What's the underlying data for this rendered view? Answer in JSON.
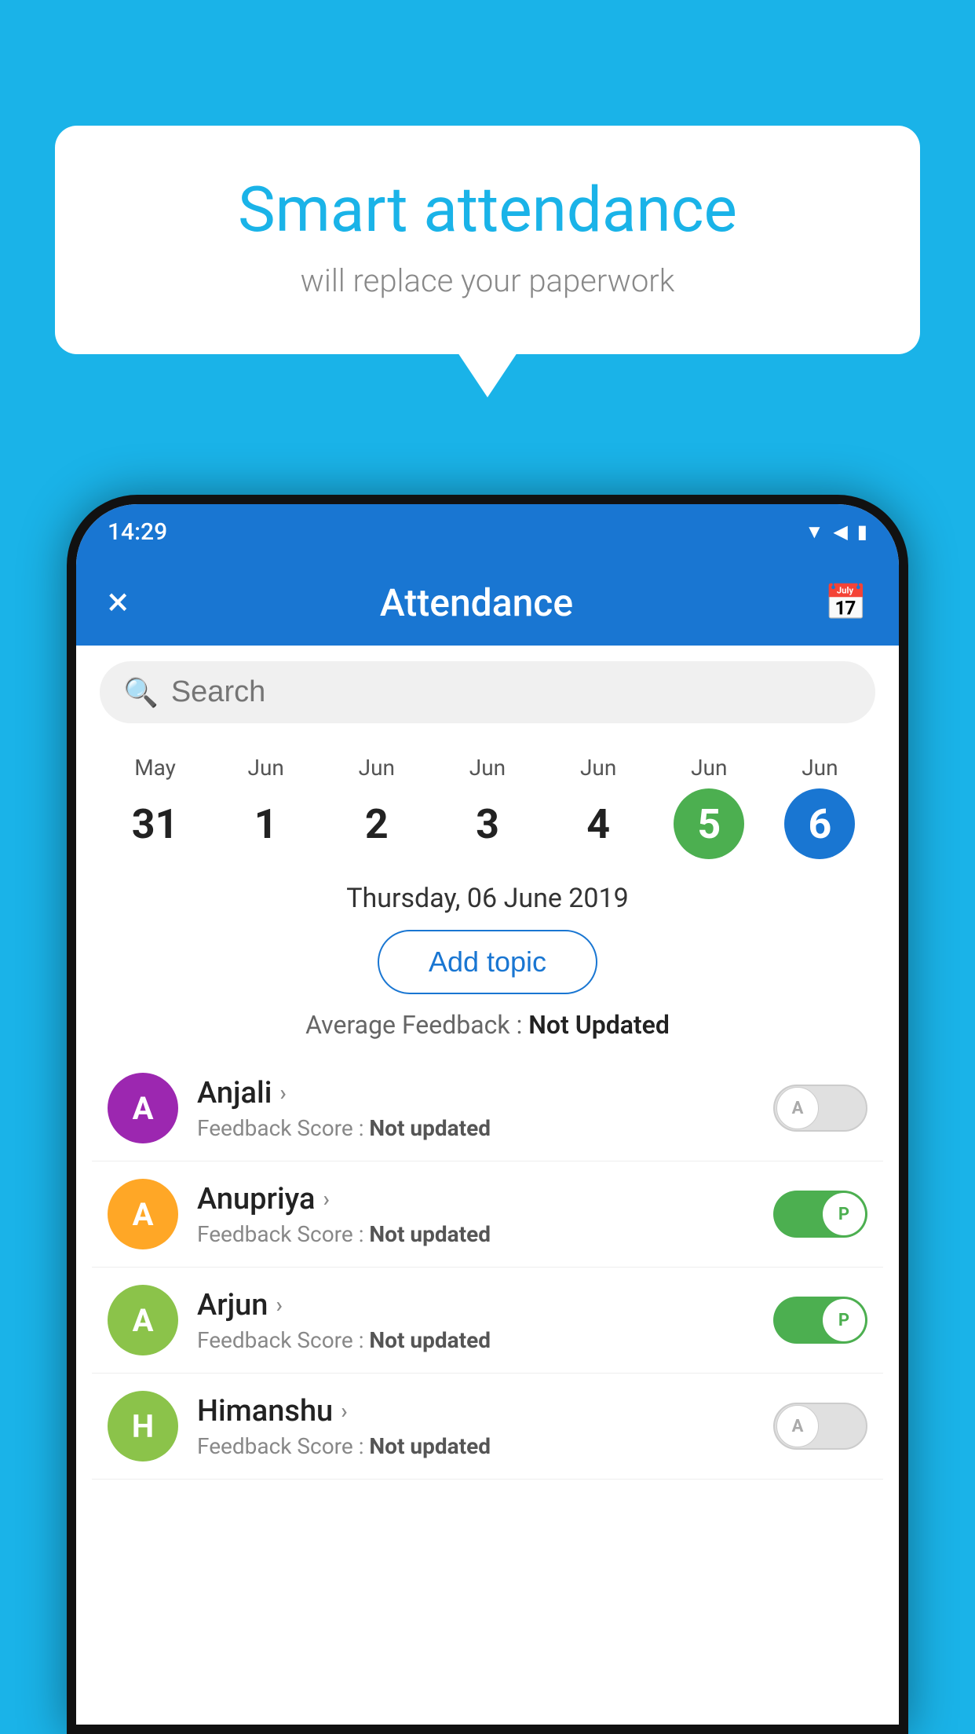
{
  "background": {
    "color": "#1ab3e8"
  },
  "bubble": {
    "title": "Smart attendance",
    "subtitle": "will replace your paperwork"
  },
  "status_bar": {
    "time": "14:29",
    "icons": [
      "wifi",
      "signal",
      "battery"
    ]
  },
  "toolbar": {
    "title": "Attendance",
    "close_label": "×",
    "calendar_label": "📅"
  },
  "search": {
    "placeholder": "Search"
  },
  "calendar": {
    "days": [
      {
        "month": "May",
        "date": "31",
        "style": "normal"
      },
      {
        "month": "Jun",
        "date": "1",
        "style": "normal"
      },
      {
        "month": "Jun",
        "date": "2",
        "style": "normal"
      },
      {
        "month": "Jun",
        "date": "3",
        "style": "normal"
      },
      {
        "month": "Jun",
        "date": "4",
        "style": "normal"
      },
      {
        "month": "Jun",
        "date": "5",
        "style": "green"
      },
      {
        "month": "Jun",
        "date": "6",
        "style": "blue"
      }
    ],
    "selected_date": "Thursday, 06 June 2019"
  },
  "add_topic_label": "Add topic",
  "avg_feedback_label": "Average Feedback : ",
  "avg_feedback_value": "Not Updated",
  "students": [
    {
      "name": "Anjali",
      "avatar_letter": "A",
      "avatar_color": "#9c27b0",
      "feedback_label": "Feedback Score : ",
      "feedback_value": "Not updated",
      "toggle": "off",
      "toggle_letter": "A"
    },
    {
      "name": "Anupriya",
      "avatar_letter": "A",
      "avatar_color": "#ffa726",
      "feedback_label": "Feedback Score : ",
      "feedback_value": "Not updated",
      "toggle": "on",
      "toggle_letter": "P"
    },
    {
      "name": "Arjun",
      "avatar_letter": "A",
      "avatar_color": "#8bc34a",
      "feedback_label": "Feedback Score : ",
      "feedback_value": "Not updated",
      "toggle": "on",
      "toggle_letter": "P"
    },
    {
      "name": "Himanshu",
      "avatar_letter": "H",
      "avatar_color": "#8bc34a",
      "feedback_label": "Feedback Score : ",
      "feedback_value": "Not updated",
      "toggle": "off",
      "toggle_letter": "A"
    }
  ]
}
